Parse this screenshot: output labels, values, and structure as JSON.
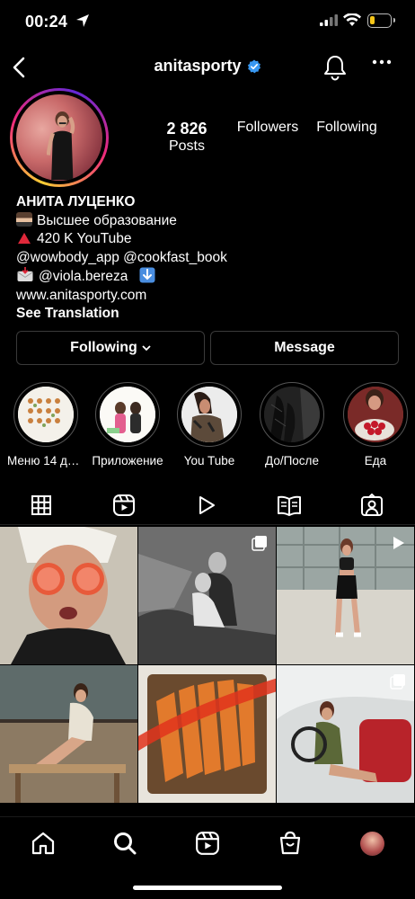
{
  "status_bar": {
    "time": "00:24"
  },
  "header": {
    "username": "anitasporty"
  },
  "stats": {
    "posts_count": "2 826",
    "posts_label": "Posts",
    "followers_label": "Followers",
    "following_label": "Following"
  },
  "bio": {
    "name": "АНИТА ЛУЦЕНКО",
    "line1": "Высшее образование",
    "line2": "420 K YouTube",
    "line3": "@wowbody_app @cookfast_book",
    "line4": "@viola.bereza",
    "link": "www.anitasporty.com",
    "translate": "See Translation"
  },
  "buttons": {
    "following": "Following",
    "message": "Message"
  },
  "highlights": [
    {
      "label": "Меню 14 дней"
    },
    {
      "label": "Приложение"
    },
    {
      "label": "You Tube"
    },
    {
      "label": "До/После"
    },
    {
      "label": "Еда"
    }
  ],
  "tabs": [
    "grid-icon",
    "reels-icon",
    "videos-icon",
    "guides-icon",
    "tagged-icon"
  ],
  "bottom_nav": [
    "home-icon",
    "search-icon",
    "reels-icon",
    "shop-icon",
    "profile-avatar"
  ],
  "colors": {
    "verified": "#3897f0",
    "background": "#000000",
    "button_border": "#3a3a3a"
  }
}
